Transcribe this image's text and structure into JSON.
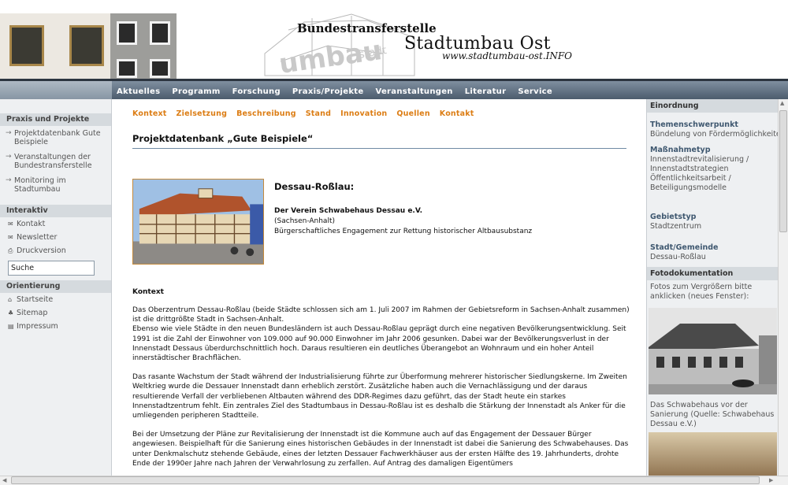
{
  "header": {
    "org_name": "Bundestransferstelle",
    "program_name": "Stadtumbau Ost",
    "url": "www.stadtumbau-ost.INFO"
  },
  "nav": {
    "items": [
      "Aktuelles",
      "Programm",
      "Forschung",
      "Praxis/Projekte",
      "Veranstaltungen",
      "Literatur",
      "Service"
    ]
  },
  "left_sidebar": {
    "section1_title": "Praxis und Projekte",
    "section1_links": [
      "Projektdatenbank Gute Beispiele",
      "Veranstaltungen der Bundestransferstelle",
      "Monitoring im Stadtumbau"
    ],
    "section2_title": "Interaktiv",
    "section2_links": [
      {
        "label": "Kontakt",
        "icon": "mail-icon"
      },
      {
        "label": "Newsletter",
        "icon": "newsletter-icon"
      },
      {
        "label": "Druckversion",
        "icon": "print-icon"
      }
    ],
    "search_value": "Suche",
    "section3_title": "Orientierung",
    "section3_links": [
      {
        "label": "Startseite",
        "icon": "home-icon"
      },
      {
        "label": "Sitemap",
        "icon": "sitemap-icon"
      },
      {
        "label": "Impressum",
        "icon": "document-icon"
      }
    ]
  },
  "main": {
    "subnav": [
      "Kontext",
      "Zielsetzung",
      "Beschreibung",
      "Stand",
      "Innovation",
      "Quellen",
      "Kontakt"
    ],
    "page_title": "Projektdatenbank „Gute Beispiele“",
    "place": "Dessau-Roßlau:",
    "organization": "Der Verein Schwabehaus Dessau e.V.",
    "region": "(Sachsen-Anhalt)",
    "tagline": "Bürgerschaftliches Engagement zur Rettung historischer Altbausubstanz",
    "kontext_heading": "Kontext",
    "paragraphs": [
      "Das Oberzentrum Dessau-Roßlau (beide Städte schlossen sich am 1. Juli 2007 im Rahmen der Gebietsreform in Sachsen-Anhalt zusammen) ist die drittgrößte Stadt in Sachsen-Anhalt.",
      "Ebenso wie viele Städte in den neuen Bundesländern ist auch Dessau-Roßlau geprägt durch eine negativen Bevölkerungsentwicklung. Seit 1991 ist die Zahl der Einwohner von 109.000 auf 90.000 Einwohner im Jahr 2006 gesunken. Dabei war der Bevölkerungsverlust in der Innenstadt Dessaus überdurchschnittlich hoch. Daraus resultieren ein deutliches Überangebot an Wohnraum und ein hoher Anteil innerstädtischer Brachflächen.",
      "Das rasante Wachstum der Stadt während der Industrialisierung führte zur Überformung mehrerer historischer Siedlungskerne. Im Zweiten Weltkrieg wurde die Dessauer Innenstadt dann erheblich zerstört. Zusätzliche haben auch die Vernachlässigung und der daraus resultierende Verfall der verbliebenen Altbauten während des DDR-Regimes dazu geführt, das der Stadt heute ein starkes Innenstadtzentrum fehlt. Ein zentrales Ziel des Stadtumbaus in Dessau-Roßlau ist es deshalb die Stärkung der Innenstadt als Anker für die umliegenden peripheren Stadtteile.",
      "Bei der Umsetzung der Pläne zur Revitalisierung der Innenstadt ist die Kommune auch auf das Engagement der Dessauer Bürger angewiesen. Beispielhaft für die Sanierung eines historischen Gebäudes in der Innenstadt ist dabei die Sanierung des Schwabehauses. Das unter Denkmalschutz stehende Gebäude, eines der letzten Dessauer Fachwerkhäuser aus der ersten Hälfte des 19. Jahrhunderts, drohte Ende der 1990er Jahre nach Jahren der Verwahrlosung zu zerfallen. Auf Antrag des damaligen Eigentümers"
    ]
  },
  "right_sidebar": {
    "einordnung_title": "Einordnung",
    "themen_label": "Themenschwerpunkt",
    "themen_value": "Bündelung von Fördermöglichkeiten",
    "massnahme_label": "Maßnahmetyp",
    "massnahme_values": [
      "Innenstadtrevitalisierung /",
      "Innenstadtstrategien",
      "Öffentlichkeitsarbeit /",
      "Beteiligungsmodelle"
    ],
    "gebiet_label": "Gebietstyp",
    "gebiet_value": "Stadtzentrum",
    "stadt_label": "Stadt/Gemeinde",
    "stadt_value": "Dessau-Roßlau",
    "foto_title": "Fotodokumentation",
    "foto_hint": "Fotos zum Vergrößern bitte anklicken (neues Fenster):",
    "caption": "Das Schwabehaus vor der Sanierung (Quelle: Schwabehaus Dessau e.V.)"
  },
  "colors": {
    "nav_bg": "#5a6a7b",
    "subnav_orange": "#dc7d14",
    "sidebar_bg": "#eef0f2",
    "section_bg": "#d5dade",
    "label_blue": "#3f5870"
  }
}
